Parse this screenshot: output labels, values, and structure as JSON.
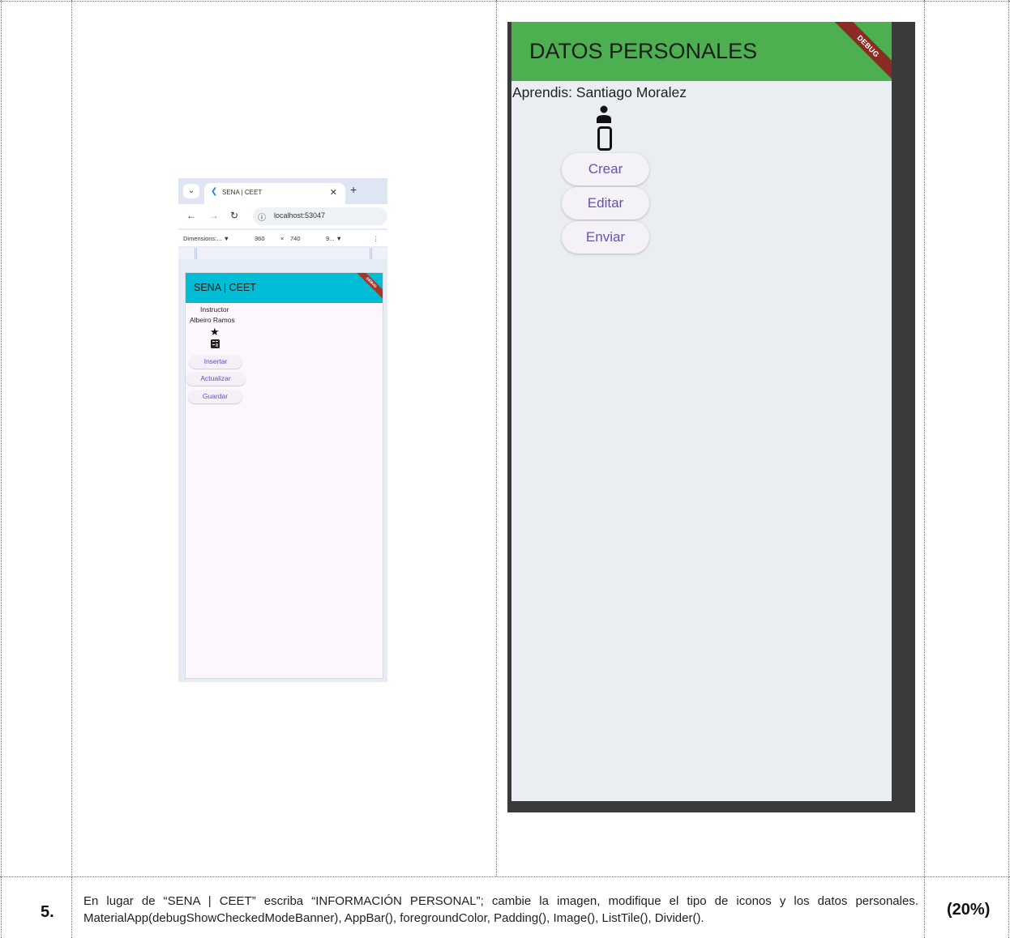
{
  "browser": {
    "tab_title": "SENA | CEET",
    "url": "localhost:53047",
    "devtools": {
      "dimensions": "Dimensions:...",
      "width": "360",
      "times": "×",
      "height": "740",
      "zoom": "9..."
    },
    "app": {
      "title": "SENA | CEET",
      "debug": "DEBUG",
      "line1": "Instructor",
      "line2": "Albeiro Ramos",
      "icons": [
        "star-icon",
        "calculator-icon"
      ],
      "buttons": [
        "Insertar",
        "Actualizar",
        "Guardar"
      ],
      "appbar_color": "#00bcd4"
    }
  },
  "flutter": {
    "title": "DATOS PERSONALES",
    "debug": "DEBUG",
    "subtitle": "Aprendis: Santiago Moralez",
    "icons": [
      "person-icon",
      "smartphone-icon"
    ],
    "buttons": [
      "Crear",
      "Editar",
      "Enviar"
    ],
    "appbar_color": "#4caf50"
  },
  "row": {
    "number": "5.",
    "text": "En lugar de “SENA | CEET” escriba “INFORMACIÓN PERSONAL”; cambie la imagen, modifique el tipo de iconos y los datos personales. MaterialApp(debugShowCheckedModeBanner), AppBar(), foregroundColor, Padding(), Image(), ListTile(), Divider().",
    "percent": "(20%)"
  }
}
